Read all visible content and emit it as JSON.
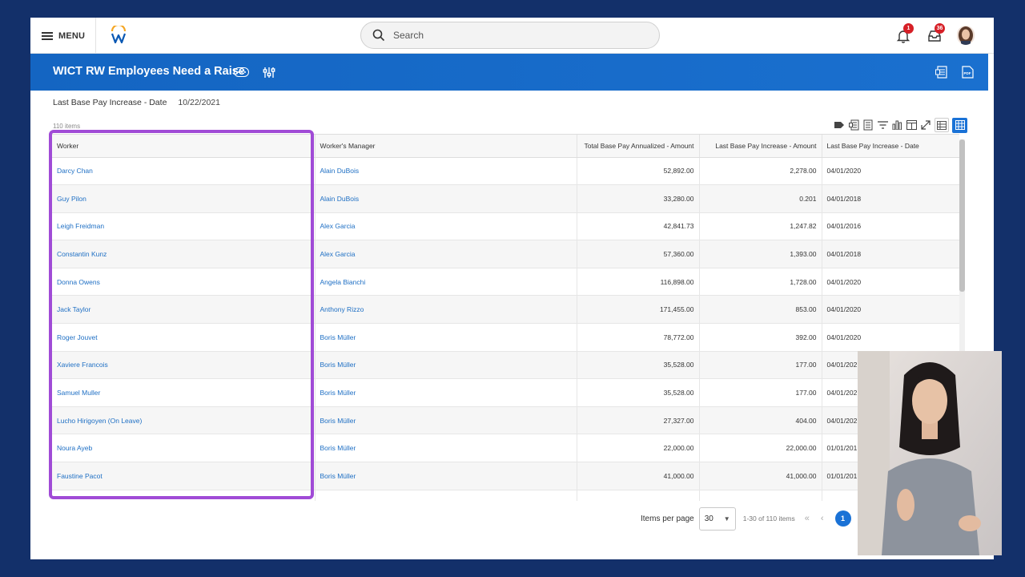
{
  "topbar": {
    "menu_label": "MENU",
    "search_placeholder": "Search",
    "notifications_count": "1",
    "inbox_count": "36"
  },
  "report": {
    "title": "WICT RW Employees Need a Raise",
    "filter_label": "Last Base Pay Increase - Date",
    "filter_value": "10/22/2021",
    "item_count": "110 items"
  },
  "table": {
    "columns": [
      "Worker",
      "Worker's Manager",
      "Total Base Pay Annualized - Amount",
      "Last Base Pay Increase - Amount",
      "Last Base Pay Increase - Date"
    ],
    "rows": [
      [
        "Darcy Chan",
        "Alain DuBois",
        "52,892.00",
        "2,278.00",
        "04/01/2020"
      ],
      [
        "Guy Pilon",
        "Alain DuBois",
        "33,280.00",
        "0.201",
        "04/01/2018"
      ],
      [
        "Leigh Freidman",
        "Alex Garcia",
        "42,841.73",
        "1,247.82",
        "04/01/2016"
      ],
      [
        "Constantin Kunz",
        "Alex Garcia",
        "57,360.00",
        "1,393.00",
        "04/01/2018"
      ],
      [
        "Donna Owens",
        "Angela Bianchi",
        "116,898.00",
        "1,728.00",
        "04/01/2020"
      ],
      [
        "Jack Taylor",
        "Anthony Rizzo",
        "171,455.00",
        "853.00",
        "04/01/2020"
      ],
      [
        "Roger Jouvet",
        "Boris Müller",
        "78,772.00",
        "392.00",
        "04/01/2020"
      ],
      [
        "Xaviere Francois",
        "Boris Müller",
        "35,528.00",
        "177.00",
        "04/01/202"
      ],
      [
        "Samuel Muller",
        "Boris Müller",
        "35,528.00",
        "177.00",
        "04/01/202"
      ],
      [
        "Lucho Hirigoyen (On Leave)",
        "Boris Müller",
        "27,327.00",
        "404.00",
        "04/01/202"
      ],
      [
        "Noura Ayeb",
        "Boris Müller",
        "22,000.00",
        "22,000.00",
        "01/01/201"
      ],
      [
        "Faustine Pacot",
        "Boris Müller",
        "41,000.00",
        "41,000.00",
        "01/01/201"
      ],
      [
        "",
        "",
        "",
        "",
        ""
      ]
    ]
  },
  "pagination": {
    "items_per_page_label": "Items per page",
    "items_per_page_value": "30",
    "range_text": "1-30 of 110 items",
    "current_page": "1"
  },
  "colors": {
    "banner": "#1a6dca",
    "link": "#1e6fc4",
    "highlight": "#a04bd6",
    "frame_background": "#13306a"
  },
  "icons": [
    "hamburger-icon",
    "workday-logo",
    "search-icon",
    "bell-icon",
    "inbox-icon",
    "related-actions-icon",
    "tune-icon",
    "export-excel-icon",
    "export-pdf-icon",
    "tag-icon",
    "table-icon",
    "filter-icon",
    "chart-icon",
    "columns-icon",
    "fullscreen-icon",
    "grid-view-icon"
  ]
}
